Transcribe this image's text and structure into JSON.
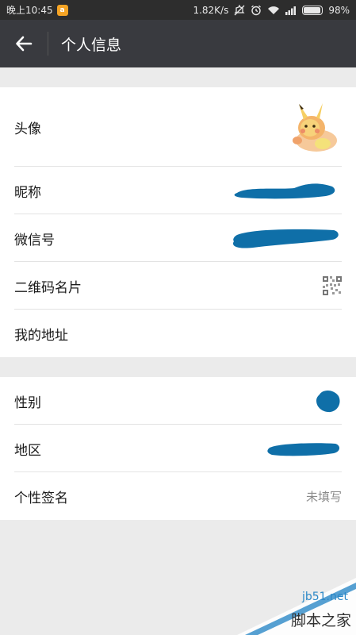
{
  "status_bar": {
    "time": "晚上10:45",
    "app_badge": "a",
    "network_speed": "1.82K/s",
    "battery_percent": "98%",
    "icons": [
      "notification-off-icon",
      "alarm-icon",
      "wifi-icon",
      "signal-icon",
      "battery-icon"
    ]
  },
  "app_bar": {
    "back_icon": "arrow-left-icon",
    "title": "个人信息"
  },
  "section1": {
    "rows": [
      {
        "label": "头像",
        "type": "avatar",
        "avatar_icon": "pikachu-avatar"
      },
      {
        "label": "昵称",
        "type": "redacted"
      },
      {
        "label": "微信号",
        "type": "redacted"
      },
      {
        "label": "二维码名片",
        "type": "icon",
        "icon": "qr-code-icon"
      },
      {
        "label": "我的地址",
        "type": "none"
      }
    ]
  },
  "section2": {
    "rows": [
      {
        "label": "性别",
        "type": "redacted"
      },
      {
        "label": "地区",
        "type": "redacted"
      },
      {
        "label": "个性签名",
        "type": "text",
        "value": "未填写"
      }
    ]
  },
  "watermark": {
    "site": "jb51.net",
    "name": "脚本之家"
  },
  "colors": {
    "status_bar": "#2d2d2d",
    "app_bar": "#393a3f",
    "background": "#ebebeb",
    "redaction": "#0f6fa8"
  }
}
